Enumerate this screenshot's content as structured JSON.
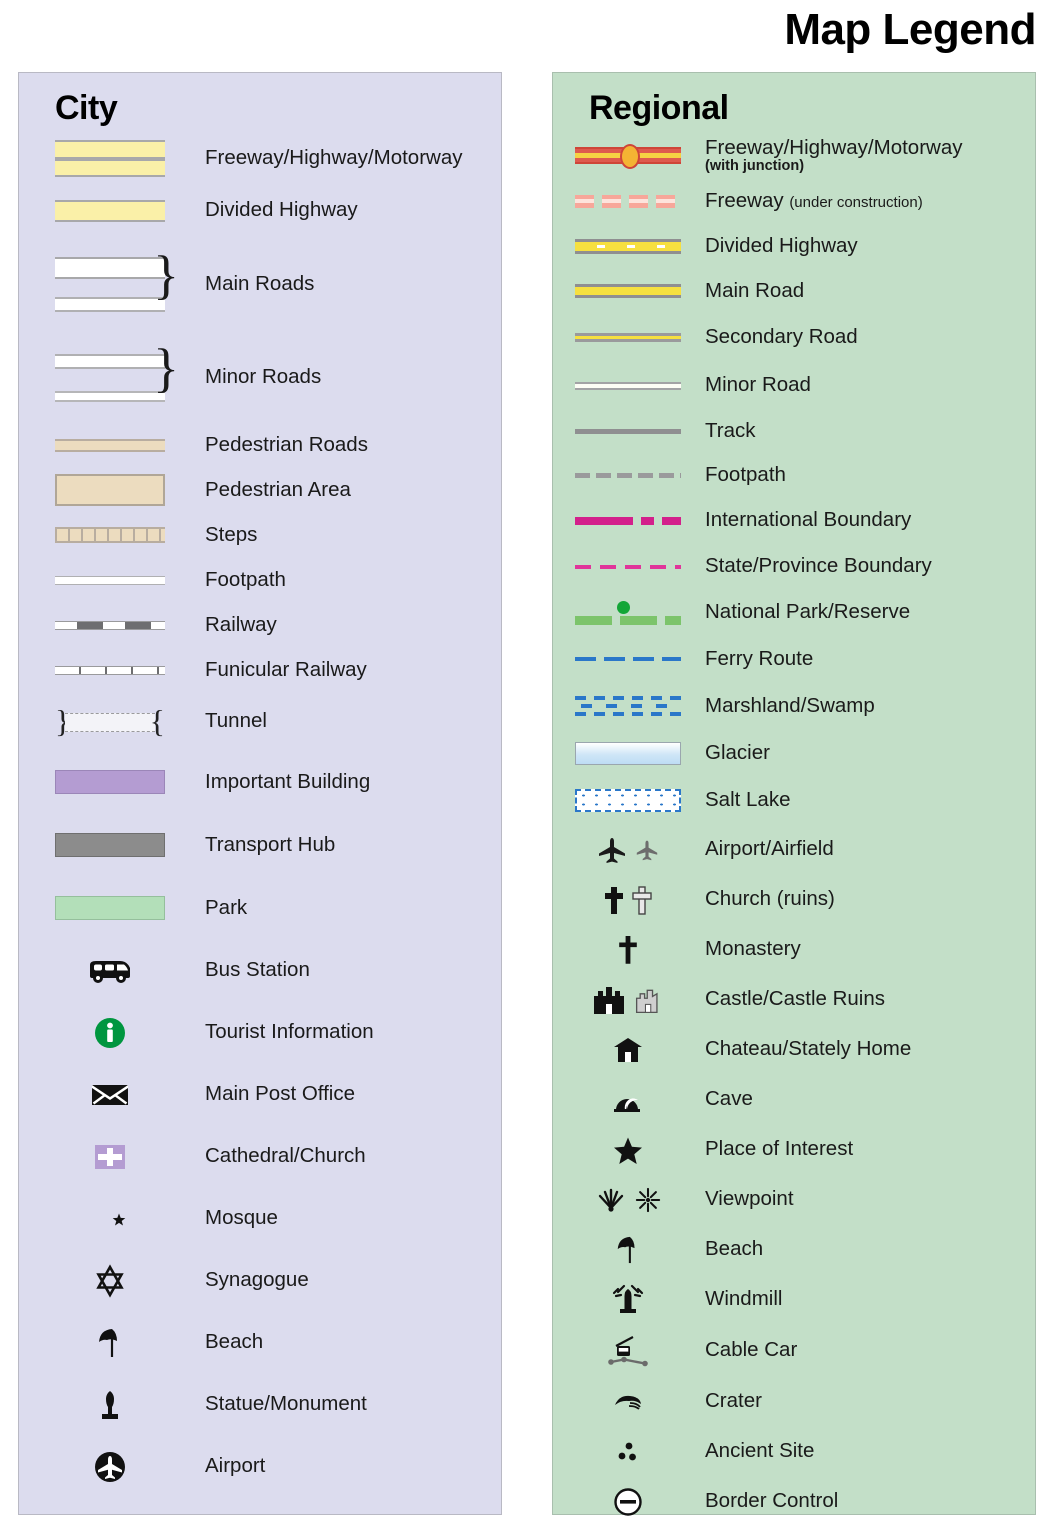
{
  "title": "Map Legend",
  "city": {
    "heading": "City",
    "bg": "#dcdcee",
    "items": [
      {
        "label": "Freeway/Highway/Motorway",
        "symbol": "freeway-double-yellow-band"
      },
      {
        "label": "Divided Highway",
        "symbol": "single-yellow-band"
      },
      {
        "label": "Main Roads",
        "symbol": "two-white-bands-braced"
      },
      {
        "label": "Minor Roads",
        "symbol": "two-thin-white-bands-braced"
      },
      {
        "label": "Pedestrian Roads",
        "symbol": "tan-band"
      },
      {
        "label": "Pedestrian Area",
        "symbol": "tan-filled-rectangle"
      },
      {
        "label": "Steps",
        "symbol": "segmented-tan-band"
      },
      {
        "label": "Footpath",
        "symbol": "thin-white-band"
      },
      {
        "label": "Railway",
        "symbol": "black-white-dashed-line"
      },
      {
        "label": "Funicular Railway",
        "symbol": "ticked-line"
      },
      {
        "label": "Tunnel",
        "symbol": "dashed-band-with-brackets"
      },
      {
        "label": "Important Building",
        "symbol": "purple-filled-rectangle"
      },
      {
        "label": "Transport Hub",
        "symbol": "gray-filled-rectangle"
      },
      {
        "label": "Park",
        "symbol": "green-filled-rectangle"
      },
      {
        "label": "Bus Station",
        "symbol": "bus-icon"
      },
      {
        "label": "Tourist Information",
        "symbol": "green-info-circle-icon"
      },
      {
        "label": "Main Post Office",
        "symbol": "envelope-icon"
      },
      {
        "label": "Cathedral/Church",
        "symbol": "purple-square-cross-icon"
      },
      {
        "label": "Mosque",
        "symbol": "crescent-star-icon"
      },
      {
        "label": "Synagogue",
        "symbol": "star-of-david-icon"
      },
      {
        "label": "Beach",
        "symbol": "beach-umbrella-icon"
      },
      {
        "label": "Statue/Monument",
        "symbol": "statue-icon"
      },
      {
        "label": "Airport",
        "symbol": "airplane-circle-icon"
      }
    ]
  },
  "regional": {
    "heading": "Regional",
    "bg": "#c3dfc8",
    "items": [
      {
        "label": "Freeway/Highway/Motorway",
        "sublabel": "(with junction)",
        "symbol": "red-freeway-with-junction"
      },
      {
        "label": "Freeway",
        "sublabel": "(under construction)",
        "symbol": "dashed-pink-freeway"
      },
      {
        "label": "Divided Highway",
        "symbol": "gray-yellow-divided-band"
      },
      {
        "label": "Main Road",
        "symbol": "yellow-band-gray-casing"
      },
      {
        "label": "Secondary Road",
        "symbol": "thin-yellow-band"
      },
      {
        "label": "Minor Road",
        "symbol": "thin-white-band-gray-casing"
      },
      {
        "label": "Track",
        "symbol": "solid-gray-line"
      },
      {
        "label": "Footpath",
        "symbol": "gray-dashed-line"
      },
      {
        "label": "International Boundary",
        "symbol": "magenta-dash-dot-line"
      },
      {
        "label": "State/Province Boundary",
        "symbol": "pink-dashed-line"
      },
      {
        "label": "National Park/Reserve",
        "symbol": "green-dashed-line-with-dot"
      },
      {
        "label": "Ferry Route",
        "symbol": "blue-dashed-line"
      },
      {
        "label": "Marshland/Swamp",
        "symbol": "blue-marsh-hatching"
      },
      {
        "label": "Glacier",
        "symbol": "pale-blue-gradient-rectangle"
      },
      {
        "label": "Salt Lake",
        "symbol": "dotted-white-blue-dashed-rectangle"
      },
      {
        "label": "Airport/Airfield",
        "symbol": "airplane-icon-pair"
      },
      {
        "label": "Church (ruins)",
        "symbol": "cross-icon-pair"
      },
      {
        "label": "Monastery",
        "symbol": "cross-icon"
      },
      {
        "label": "Castle/Castle Ruins",
        "symbol": "castle-icon-pair"
      },
      {
        "label": "Chateau/Stately Home",
        "symbol": "chateau-house-icon"
      },
      {
        "label": "Cave",
        "symbol": "cave-icon"
      },
      {
        "label": "Place of Interest",
        "symbol": "star-icon"
      },
      {
        "label": "Viewpoint",
        "symbol": "viewpoint-icon-pair"
      },
      {
        "label": "Beach",
        "symbol": "beach-umbrella-icon"
      },
      {
        "label": "Windmill",
        "symbol": "windmill-icon"
      },
      {
        "label": "Cable Car",
        "symbol": "cable-car-icon"
      },
      {
        "label": "Crater",
        "symbol": "crater-icon"
      },
      {
        "label": "Ancient Site",
        "symbol": "three-dots-icon"
      },
      {
        "label": "Border Control",
        "symbol": "circled-minus-icon"
      }
    ]
  }
}
